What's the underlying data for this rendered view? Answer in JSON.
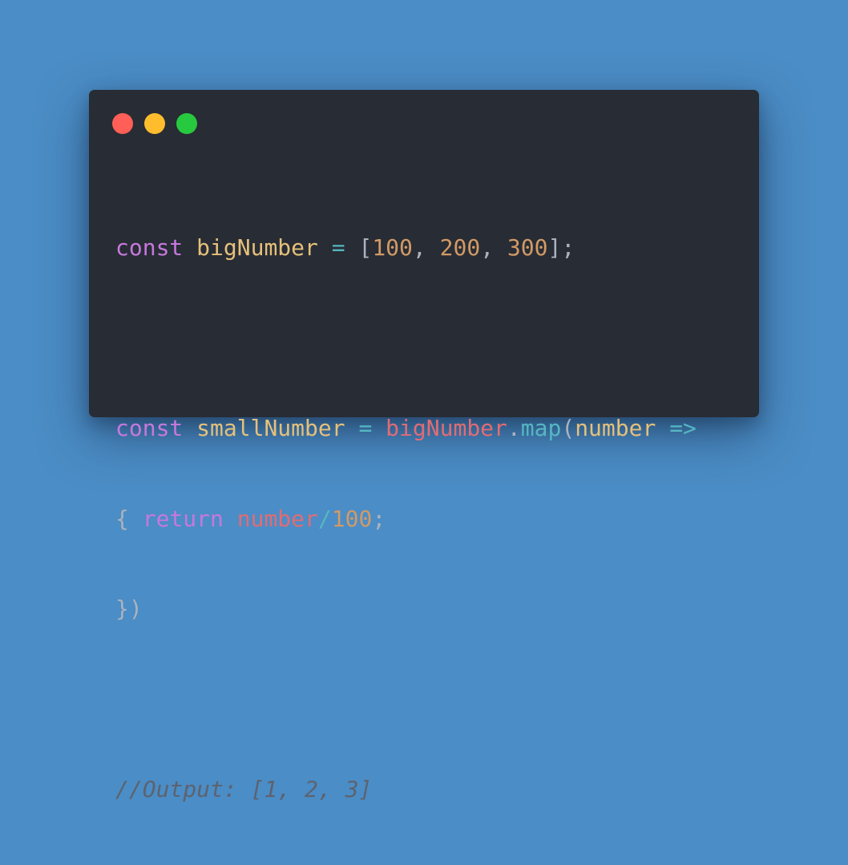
{
  "window": {
    "controls": [
      "close",
      "minimize",
      "maximize"
    ],
    "colors": {
      "background": "#282c34",
      "page": "#4b8dc6",
      "close": "#ff5f56",
      "minimize": "#ffbd2e",
      "maximize": "#27c93f"
    }
  },
  "code": {
    "line1": {
      "kw": "const",
      "name": "bigNumber",
      "eq": "=",
      "open": "[",
      "n1": "100",
      "c1": ",",
      "n2": "200",
      "c2": ",",
      "n3": "300",
      "close": "];"
    },
    "line2": {
      "kw": "const",
      "name": "smallNumber",
      "eq": "=",
      "ref": "bigNumber",
      "dot": ".",
      "method": "map",
      "paren": "(",
      "param": "number",
      "arrow": "=>"
    },
    "line3": {
      "brace": "{",
      "kw": "return",
      "ref": "number",
      "slash": "/",
      "num": "100",
      "semi": ";"
    },
    "line4": {
      "close": "})"
    },
    "comment": "//Output: [1, 2, 3]"
  }
}
